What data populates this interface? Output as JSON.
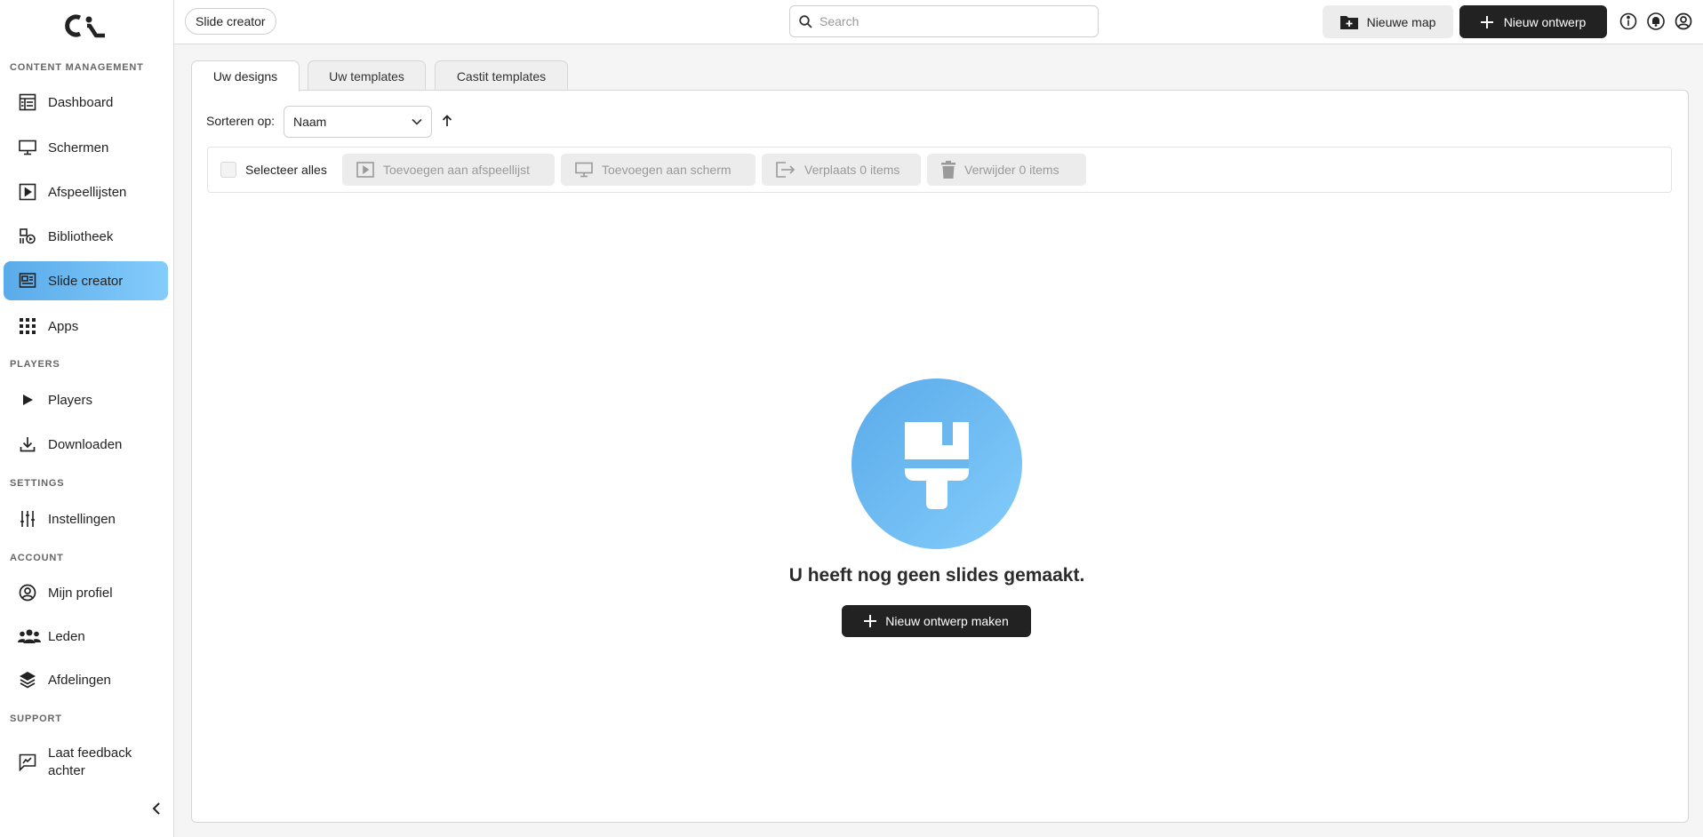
{
  "sidebar": {
    "sections": {
      "content_management": "CONTENT MANAGEMENT",
      "players": "PLAYERS",
      "settings": "SETTINGS",
      "account": "ACCOUNT",
      "support": "SUPPORT"
    },
    "items": {
      "dashboard": "Dashboard",
      "schermen": "Schermen",
      "afspeellijsten": "Afspeellijsten",
      "bibliotheek": "Bibliotheek",
      "slide_creator": "Slide creator",
      "apps": "Apps",
      "players": "Players",
      "downloaden": "Downloaden",
      "instellingen": "Instellingen",
      "mijn_profiel": "Mijn profiel",
      "leden": "Leden",
      "afdelingen": "Afdelingen",
      "feedback_line1": "Laat feedback",
      "feedback_line2": "achter"
    },
    "active_item": "slide_creator",
    "active_color": "#5aabea"
  },
  "header": {
    "breadcrumb": "Slide creator",
    "search_placeholder": "Search",
    "new_folder_label": "Nieuwe map",
    "new_design_label": "Nieuw ontwerp"
  },
  "tabs": {
    "uw_designs": "Uw designs",
    "uw_templates": "Uw templates",
    "castit_templates": "Castit templates",
    "active": "uw_designs"
  },
  "toolbar": {
    "sort_label": "Sorteren op:",
    "sort_value": "Naam",
    "select_all": "Selecteer alles",
    "add_to_playlist": "Toevoegen aan afspeellijst",
    "add_to_screen": "Toevoegen aan scherm",
    "move_items": "Verplaats 0 items",
    "delete_items": "Verwijder 0 items"
  },
  "empty_state": {
    "message": "U heeft nog geen slides gemaakt.",
    "button_label": "Nieuw ontwerp maken"
  },
  "icons": {
    "logo": "castit-logo",
    "search": "search-icon",
    "folder_plus": "folder-plus-icon",
    "plus": "plus-icon",
    "info": "info-icon",
    "bell": "bell-icon",
    "user": "user-circle-icon",
    "paintbrush": "paintbrush-icon"
  }
}
